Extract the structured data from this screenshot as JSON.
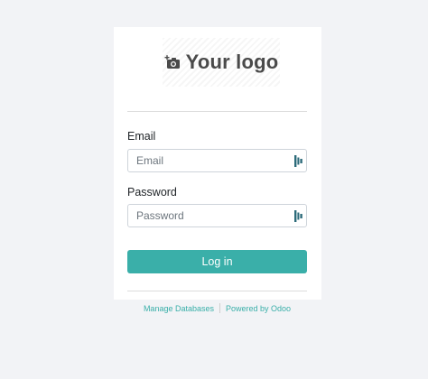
{
  "logo": {
    "text": "Your logo",
    "icon": "camera-plus-icon"
  },
  "form": {
    "email": {
      "label": "Email",
      "placeholder": "Email",
      "value": ""
    },
    "password": {
      "label": "Password",
      "placeholder": "Password",
      "value": ""
    },
    "submit_label": "Log in"
  },
  "footer": {
    "manage_label": "Manage Databases",
    "powered_label": "Powered by Odoo"
  },
  "colors": {
    "accent": "#3aafa9",
    "background": "#f2f3f6",
    "card": "#ffffff"
  }
}
